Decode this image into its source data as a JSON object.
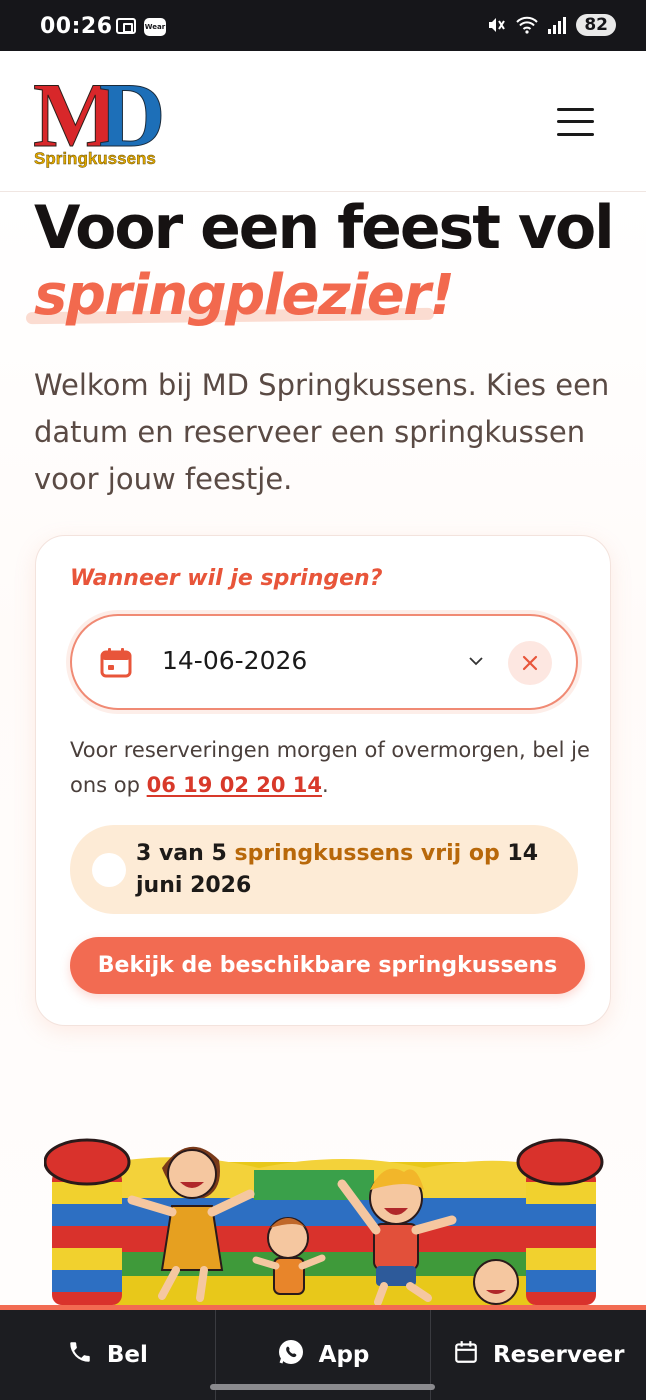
{
  "status_bar": {
    "time": "00:26",
    "wear_label": "Wear",
    "battery": "82",
    "icons": [
      "screenshot-icon",
      "wear-icon",
      "mute-icon",
      "wifi-icon",
      "signal-icon",
      "battery-icon"
    ]
  },
  "header": {
    "logo_main_m": "M",
    "logo_main_d": "D",
    "logo_sub": "Springkussens",
    "menu_icon": "hamburger-menu-icon"
  },
  "hero": {
    "title": "Voor een feest vol",
    "accent": "springplezier!",
    "intro": "Welkom bij MD Springkussens. Kies een datum en reserveer een springkussen voor jouw feestje."
  },
  "booking": {
    "question": "Wanneer wil je springen?",
    "date_value": "14-06-2026",
    "note_prefix": "Voor reserveringen morgen of overmorgen, bel je ons op ",
    "note_phone": "06 19 02 20 14",
    "note_suffix": ".",
    "availability": {
      "lead": "3 van 5",
      "middle": "springkussens vrij op",
      "date": "14 juni 2026"
    },
    "cta": "Bekijk de beschikbare springkussens"
  },
  "bottom_nav": {
    "items": [
      {
        "label": "Bel",
        "icon": "phone-icon"
      },
      {
        "label": "App",
        "icon": "whatsapp-icon"
      },
      {
        "label": "Reserveer",
        "icon": "calendar-icon"
      }
    ]
  },
  "colors": {
    "accent": "#f26b52",
    "dark": "#1c1d21",
    "availability_bg": "#fdebd6",
    "availability_text": "#b8680a"
  }
}
